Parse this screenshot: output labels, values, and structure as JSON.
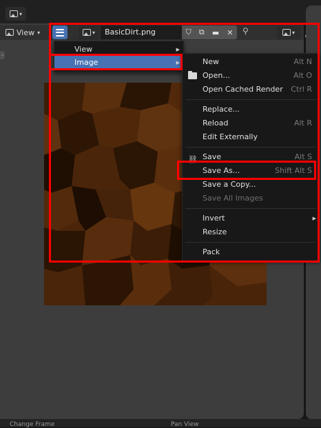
{
  "header": {
    "view_label": "View",
    "image_name": "BasicDirt.png"
  },
  "main_menu": {
    "items": [
      {
        "label": "View"
      },
      {
        "label": "Image",
        "active": true
      }
    ]
  },
  "image_menu": {
    "items": [
      {
        "label": "New",
        "shortcut": "Alt N"
      },
      {
        "label": "Open...",
        "shortcut": "Alt O"
      },
      {
        "label": "Open Cached Render",
        "shortcut": "Ctrl R"
      },
      {
        "label": "Replace...",
        "shortcut": ""
      },
      {
        "label": "Reload",
        "shortcut": "Alt R"
      },
      {
        "label": "Edit Externally",
        "shortcut": ""
      },
      {
        "label": "Save",
        "shortcut": "Alt S"
      },
      {
        "label": "Save As...",
        "shortcut": "Shift Alt S"
      },
      {
        "label": "Save a Copy...",
        "shortcut": ""
      },
      {
        "label": "Save All Images",
        "shortcut": ""
      },
      {
        "label": "Invert",
        "shortcut": ""
      },
      {
        "label": "Resize",
        "shortcut": ""
      },
      {
        "label": "Pack",
        "shortcut": ""
      }
    ]
  },
  "status": {
    "left": "Change Frame",
    "right": "Pan View"
  },
  "colors": {
    "highlight": "#4772b3",
    "annotation": "#ff0000",
    "texture_base": "#4a2509"
  },
  "icons": [
    "image-editor-icon",
    "hamburger-menu-icon",
    "image-icon",
    "shield-icon",
    "duplicate-icon",
    "folder-icon",
    "close-icon",
    "pin-icon",
    "display-mode-icon",
    "link-icon"
  ]
}
